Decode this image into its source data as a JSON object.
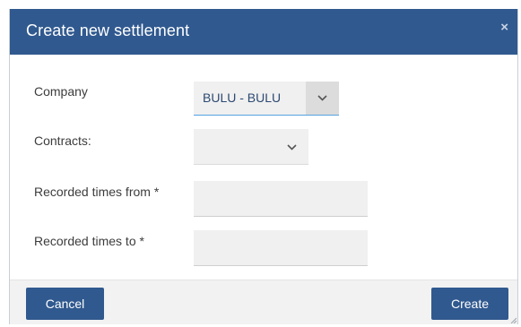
{
  "dialog": {
    "title": "Create new settlement",
    "close_label": "×"
  },
  "form": {
    "company_label": "Company",
    "company_value": "BULU - BULU",
    "contracts_label": "Contracts:",
    "contracts_value": "",
    "recorded_from_label": "Recorded times from *",
    "recorded_from_value": "",
    "recorded_to_label": "Recorded times to *",
    "recorded_to_value": ""
  },
  "footer": {
    "cancel_label": "Cancel",
    "create_label": "Create"
  },
  "colors": {
    "titlebar": "#30598f",
    "button": "#30598f",
    "focus_underline": "#53a3e0"
  },
  "icons": {
    "close": "close-icon",
    "dropdown": "chevron-down-icon"
  }
}
